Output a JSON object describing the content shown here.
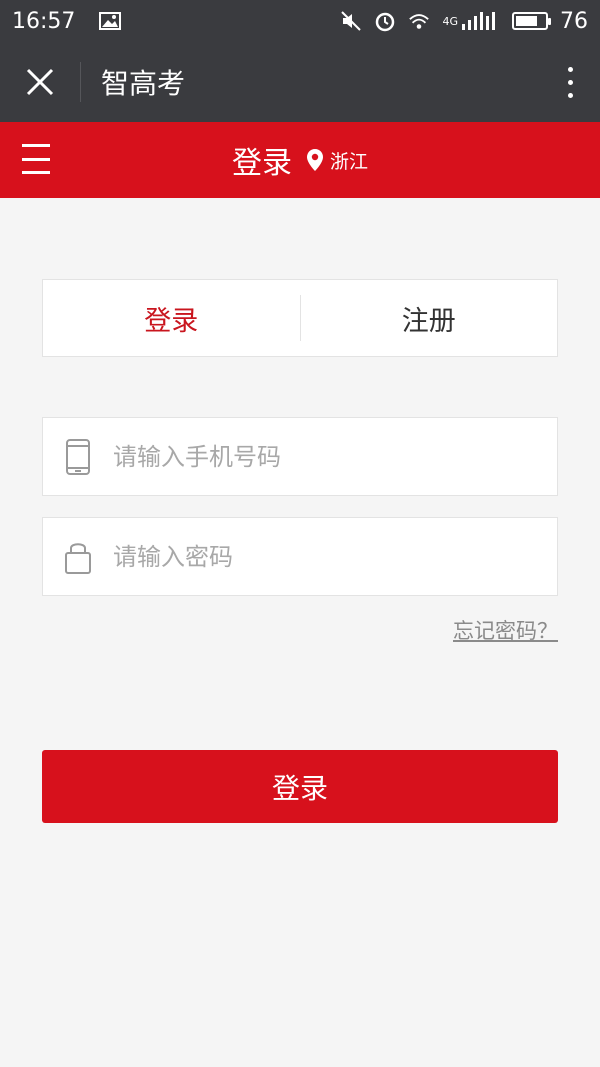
{
  "status_bar": {
    "time": "16:57",
    "network": "4G",
    "battery": "76",
    "battery_level": 0.76
  },
  "wechat_bar": {
    "title": "智高考"
  },
  "header": {
    "title": "登录",
    "location": "浙江"
  },
  "tabs": [
    {
      "label": "登录",
      "active": true
    },
    {
      "label": "注册",
      "active": false
    }
  ],
  "form": {
    "phone_placeholder": "请输入手机号码",
    "password_placeholder": "请输入密码",
    "forgot_label": "忘记密码？",
    "submit_label": "登录"
  },
  "colors": {
    "accent": "#d7111c",
    "dark_bar": "#3a3b3f",
    "active_tab": "#c9151e"
  }
}
